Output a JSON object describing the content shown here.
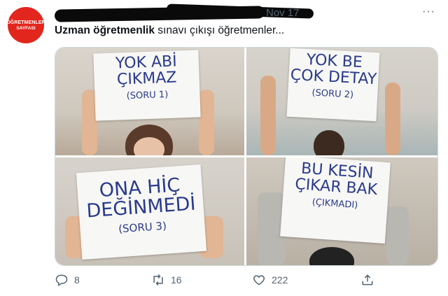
{
  "account": {
    "avatar_line1": "ÖĞRETMENLER",
    "avatar_line2": "SAYFASI"
  },
  "header": {
    "date": "Nov 17",
    "more": "···"
  },
  "tweet": {
    "text_bold": "Uzman öğretmenlik",
    "text_rest": " sınavı çıkışı öğretmenler..."
  },
  "images": [
    {
      "line1": "YOK ABİ",
      "line2": "ÇIKMAZ",
      "line3": "(SORU 1)"
    },
    {
      "line1": "YOK BE",
      "line2": "ÇOK DETAY",
      "line3": "(SORU 2)"
    },
    {
      "line1": "ONA HİÇ",
      "line2": "DEĞİNMEDİ",
      "line3": "(SORU 3)"
    },
    {
      "line1": "BU KESİN",
      "line2": "ÇIKAR BAK",
      "line3": "(ÇIKMADI)"
    }
  ],
  "actions": {
    "replies": "8",
    "retweets": "16",
    "likes": "222"
  },
  "colors": {
    "avatar_bg": "#e3261d",
    "sign_ink": "#2a3a8c",
    "muted": "#536471"
  }
}
